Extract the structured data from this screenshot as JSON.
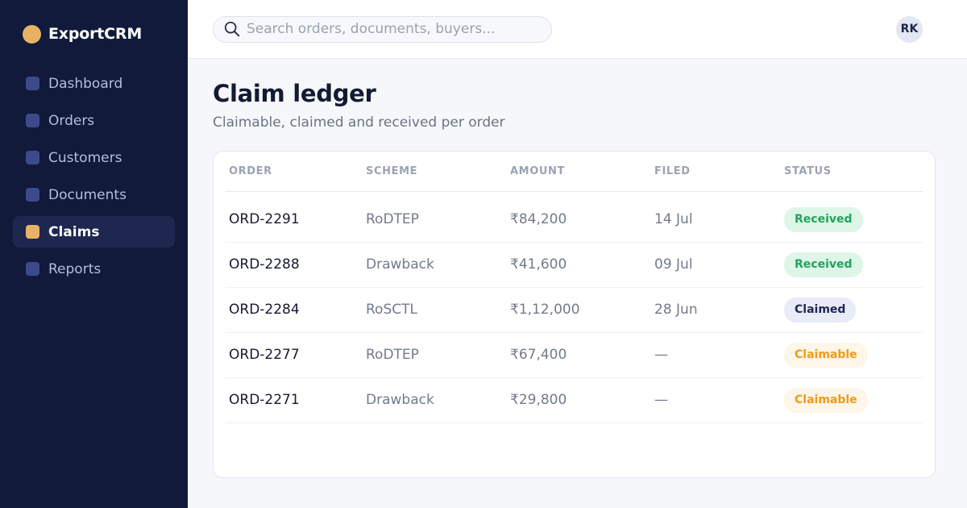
{
  "brand": {
    "name": "ExportCRM"
  },
  "sidebar": {
    "items": [
      {
        "label": "Dashboard",
        "active": false
      },
      {
        "label": "Orders",
        "active": false
      },
      {
        "label": "Customers",
        "active": false
      },
      {
        "label": "Documents",
        "active": false
      },
      {
        "label": "Claims",
        "active": true
      },
      {
        "label": "Reports",
        "active": false
      }
    ]
  },
  "search": {
    "placeholder": "Search orders, documents, buyers...",
    "value": ""
  },
  "user": {
    "initials": "RK"
  },
  "page": {
    "title": "Claim ledger",
    "subtitle": "Claimable, claimed and received per order"
  },
  "table": {
    "columns": [
      "ORDER",
      "SCHEME",
      "AMOUNT",
      "FILED",
      "STATUS"
    ],
    "rows": [
      {
        "order": "ORD-2291",
        "scheme": "RoDTEP",
        "amount": "₹84,200",
        "filed": "14 Jul",
        "status": "Received"
      },
      {
        "order": "ORD-2288",
        "scheme": "Drawback",
        "amount": "₹41,600",
        "filed": "09 Jul",
        "status": "Received"
      },
      {
        "order": "ORD-2284",
        "scheme": "RoSCTL",
        "amount": "₹1,12,000",
        "filed": "28 Jun",
        "status": "Claimed"
      },
      {
        "order": "ORD-2277",
        "scheme": "RoDTEP",
        "amount": "₹67,400",
        "filed": "—",
        "status": "Claimable"
      },
      {
        "order": "ORD-2271",
        "scheme": "Drawback",
        "amount": "₹29,800",
        "filed": "—",
        "status": "Claimable"
      }
    ]
  },
  "colors": {
    "sidebar_bg": "#111a3b",
    "accent": "#e8b265",
    "received": "#22a45d",
    "claimed": "#1e2750",
    "claimable": "#f19a1a"
  }
}
